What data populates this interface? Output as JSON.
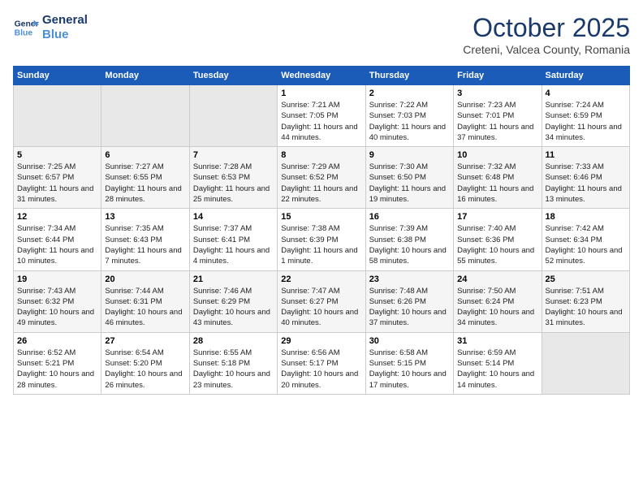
{
  "header": {
    "logo_line1": "General",
    "logo_line2": "Blue",
    "month": "October 2025",
    "location": "Creteni, Valcea County, Romania"
  },
  "weekdays": [
    "Sunday",
    "Monday",
    "Tuesday",
    "Wednesday",
    "Thursday",
    "Friday",
    "Saturday"
  ],
  "weeks": [
    [
      {
        "day": "",
        "info": ""
      },
      {
        "day": "",
        "info": ""
      },
      {
        "day": "",
        "info": ""
      },
      {
        "day": "1",
        "info": "Sunrise: 7:21 AM\nSunset: 7:05 PM\nDaylight: 11 hours and 44 minutes."
      },
      {
        "day": "2",
        "info": "Sunrise: 7:22 AM\nSunset: 7:03 PM\nDaylight: 11 hours and 40 minutes."
      },
      {
        "day": "3",
        "info": "Sunrise: 7:23 AM\nSunset: 7:01 PM\nDaylight: 11 hours and 37 minutes."
      },
      {
        "day": "4",
        "info": "Sunrise: 7:24 AM\nSunset: 6:59 PM\nDaylight: 11 hours and 34 minutes."
      }
    ],
    [
      {
        "day": "5",
        "info": "Sunrise: 7:25 AM\nSunset: 6:57 PM\nDaylight: 11 hours and 31 minutes."
      },
      {
        "day": "6",
        "info": "Sunrise: 7:27 AM\nSunset: 6:55 PM\nDaylight: 11 hours and 28 minutes."
      },
      {
        "day": "7",
        "info": "Sunrise: 7:28 AM\nSunset: 6:53 PM\nDaylight: 11 hours and 25 minutes."
      },
      {
        "day": "8",
        "info": "Sunrise: 7:29 AM\nSunset: 6:52 PM\nDaylight: 11 hours and 22 minutes."
      },
      {
        "day": "9",
        "info": "Sunrise: 7:30 AM\nSunset: 6:50 PM\nDaylight: 11 hours and 19 minutes."
      },
      {
        "day": "10",
        "info": "Sunrise: 7:32 AM\nSunset: 6:48 PM\nDaylight: 11 hours and 16 minutes."
      },
      {
        "day": "11",
        "info": "Sunrise: 7:33 AM\nSunset: 6:46 PM\nDaylight: 11 hours and 13 minutes."
      }
    ],
    [
      {
        "day": "12",
        "info": "Sunrise: 7:34 AM\nSunset: 6:44 PM\nDaylight: 11 hours and 10 minutes."
      },
      {
        "day": "13",
        "info": "Sunrise: 7:35 AM\nSunset: 6:43 PM\nDaylight: 11 hours and 7 minutes."
      },
      {
        "day": "14",
        "info": "Sunrise: 7:37 AM\nSunset: 6:41 PM\nDaylight: 11 hours and 4 minutes."
      },
      {
        "day": "15",
        "info": "Sunrise: 7:38 AM\nSunset: 6:39 PM\nDaylight: 11 hours and 1 minute."
      },
      {
        "day": "16",
        "info": "Sunrise: 7:39 AM\nSunset: 6:38 PM\nDaylight: 10 hours and 58 minutes."
      },
      {
        "day": "17",
        "info": "Sunrise: 7:40 AM\nSunset: 6:36 PM\nDaylight: 10 hours and 55 minutes."
      },
      {
        "day": "18",
        "info": "Sunrise: 7:42 AM\nSunset: 6:34 PM\nDaylight: 10 hours and 52 minutes."
      }
    ],
    [
      {
        "day": "19",
        "info": "Sunrise: 7:43 AM\nSunset: 6:32 PM\nDaylight: 10 hours and 49 minutes."
      },
      {
        "day": "20",
        "info": "Sunrise: 7:44 AM\nSunset: 6:31 PM\nDaylight: 10 hours and 46 minutes."
      },
      {
        "day": "21",
        "info": "Sunrise: 7:46 AM\nSunset: 6:29 PM\nDaylight: 10 hours and 43 minutes."
      },
      {
        "day": "22",
        "info": "Sunrise: 7:47 AM\nSunset: 6:27 PM\nDaylight: 10 hours and 40 minutes."
      },
      {
        "day": "23",
        "info": "Sunrise: 7:48 AM\nSunset: 6:26 PM\nDaylight: 10 hours and 37 minutes."
      },
      {
        "day": "24",
        "info": "Sunrise: 7:50 AM\nSunset: 6:24 PM\nDaylight: 10 hours and 34 minutes."
      },
      {
        "day": "25",
        "info": "Sunrise: 7:51 AM\nSunset: 6:23 PM\nDaylight: 10 hours and 31 minutes."
      }
    ],
    [
      {
        "day": "26",
        "info": "Sunrise: 6:52 AM\nSunset: 5:21 PM\nDaylight: 10 hours and 28 minutes."
      },
      {
        "day": "27",
        "info": "Sunrise: 6:54 AM\nSunset: 5:20 PM\nDaylight: 10 hours and 26 minutes."
      },
      {
        "day": "28",
        "info": "Sunrise: 6:55 AM\nSunset: 5:18 PM\nDaylight: 10 hours and 23 minutes."
      },
      {
        "day": "29",
        "info": "Sunrise: 6:56 AM\nSunset: 5:17 PM\nDaylight: 10 hours and 20 minutes."
      },
      {
        "day": "30",
        "info": "Sunrise: 6:58 AM\nSunset: 5:15 PM\nDaylight: 10 hours and 17 minutes."
      },
      {
        "day": "31",
        "info": "Sunrise: 6:59 AM\nSunset: 5:14 PM\nDaylight: 10 hours and 14 minutes."
      },
      {
        "day": "",
        "info": ""
      }
    ]
  ]
}
